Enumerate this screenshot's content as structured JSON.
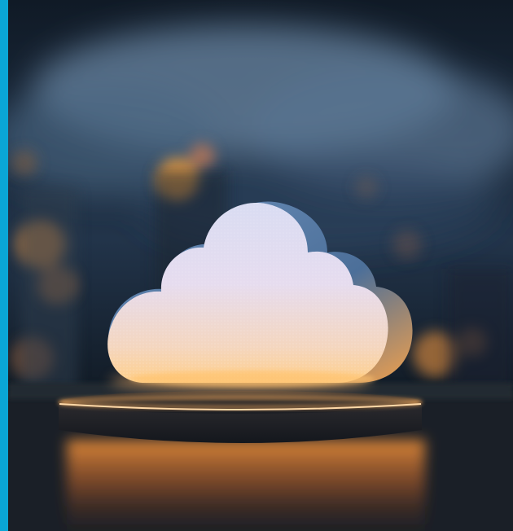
{
  "image": {
    "subject": "cloud-on-glowing-pedestal",
    "colors": {
      "accent_bar": "#0aa6d6",
      "sky_dark": "#0d141d",
      "sky_mist": "#5d7793",
      "cloud_light": "#dcdff3",
      "cloud_warm": "#f3d6b0",
      "cloud_side": "#5d83ad",
      "glow_orange": "#ff9a3c",
      "bokeh_amber": "#e79b43",
      "pedestal_dark": "#1b2029"
    }
  }
}
